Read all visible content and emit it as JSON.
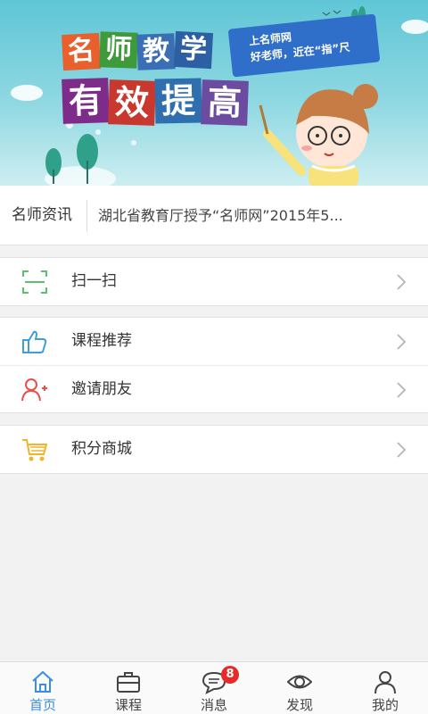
{
  "banner": {
    "tiles_row1": [
      "名",
      "师",
      "教",
      "学"
    ],
    "tiles_row2": [
      "有",
      "效",
      "提",
      "高"
    ],
    "ribbon_line1": "上名师网",
    "ribbon_line2": "好老师，近在“指”尺"
  },
  "news": {
    "title": "名师资讯",
    "text": "湖北省教育厅授予“名师网”2015年5..."
  },
  "menu": {
    "scan_label": "扫一扫",
    "recommend_label": "课程推荐",
    "invite_label": "邀请朋友",
    "shop_label": "积分商城"
  },
  "tabs": {
    "home": "首页",
    "courses": "课程",
    "messages": "消息",
    "messages_badge": "8",
    "discover": "发现",
    "mine": "我的"
  },
  "colors": {
    "accent": "#3b8fe0",
    "badge": "#e62a2a",
    "scan_icon": "#5cc06d",
    "recommend_icon": "#3b9ee0",
    "invite_icon": "#e8504b",
    "shop_icon": "#f0b429"
  }
}
